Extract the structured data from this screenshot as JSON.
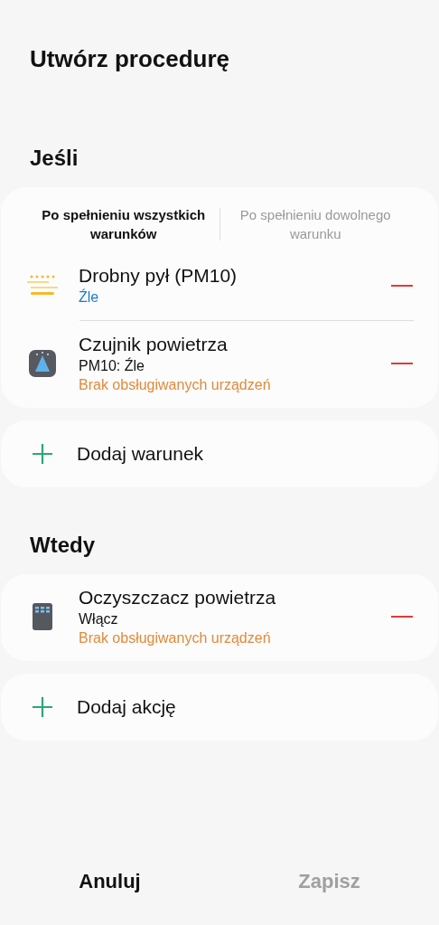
{
  "title": "Utwórz procedurę",
  "if_section": {
    "heading": "Jeśli",
    "tabs": [
      {
        "label": "Po spełnieniu wszystkich warunków",
        "selected": true
      },
      {
        "label": "Po spełnieniu dowolnego warunku",
        "selected": false
      }
    ],
    "conditions": [
      {
        "kind": "dust",
        "name": "Drobny pył (PM10)",
        "status": "Źle"
      },
      {
        "kind": "sensor",
        "name": "Czujnik powietrza",
        "detail": "PM10: Źle",
        "warning": "Brak obsługiwanych urządzeń"
      }
    ],
    "add_label": "Dodaj warunek"
  },
  "then_section": {
    "heading": "Wtedy",
    "actions": [
      {
        "kind": "purifier",
        "name": "Oczyszczacz powietrza",
        "detail": "Włącz",
        "warning": "Brak obsługiwanych urządzeń"
      }
    ],
    "add_label": "Dodaj akcję"
  },
  "buttons": [
    {
      "label": "Anuluj",
      "disabled": false
    },
    {
      "label": "Zapisz",
      "disabled": true
    }
  ]
}
